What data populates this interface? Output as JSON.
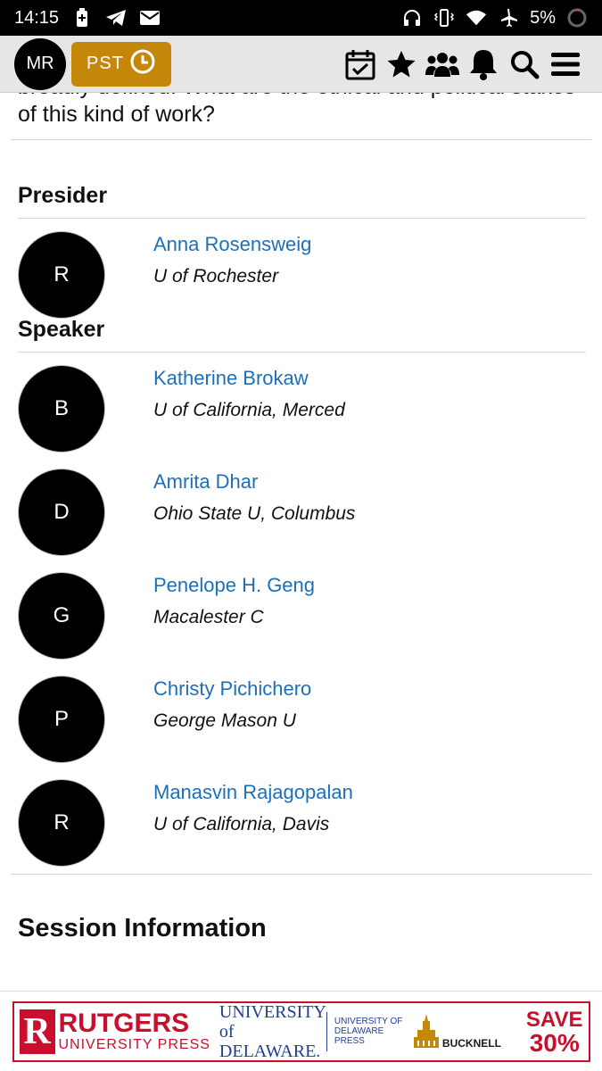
{
  "status_bar": {
    "time": "14:15",
    "battery_percent": "5%",
    "icons": [
      "battery-charging-icon",
      "telegram-icon",
      "mail-icon",
      "headphones-icon",
      "vibrate-icon",
      "wifi-icon",
      "airplane-icon",
      "battery-ring-icon"
    ]
  },
  "app_bar": {
    "avatar_initials": "MR",
    "timezone_label": "PST",
    "icons": [
      "calendar-check-icon",
      "star-icon",
      "people-icon",
      "bell-icon",
      "search-icon",
      "menu-icon"
    ],
    "accent_color": "#c4870a"
  },
  "session": {
    "description_tail": "broadly defined. What are the ethical and political stakes of this kind of work?",
    "presider_heading": "Presider",
    "presiders": [
      {
        "initial": "R",
        "name": "Anna Rosensweig",
        "affiliation": "U of Rochester"
      }
    ],
    "speaker_heading": "Speaker",
    "speakers": [
      {
        "initial": "B",
        "name": "Katherine Brokaw",
        "affiliation": "U of California, Merced"
      },
      {
        "initial": "D",
        "name": "Amrita Dhar",
        "affiliation": "Ohio State U, Columbus"
      },
      {
        "initial": "G",
        "name": "Penelope H. Geng",
        "affiliation": "Macalester C"
      },
      {
        "initial": "P",
        "name": "Christy Pichichero",
        "affiliation": "George Mason U"
      },
      {
        "initial": "R",
        "name": "Manasvin Rajagopalan",
        "affiliation": "U of California, Davis"
      }
    ],
    "info_heading": "Session Information",
    "link_color": "#1d6fb8"
  },
  "ad": {
    "rutgers_big": "RUTGERS",
    "rutgers_small": "UNIVERSITY PRESS",
    "rutgers_r": "R",
    "ud_main": "UNIVERSITY of DELAWARE.",
    "ud_press": "UNIVERSITY OF DELAWARE PRESS",
    "bucknell": "BUCKNELL",
    "save_line1": "SAVE",
    "save_line2": "30%"
  }
}
